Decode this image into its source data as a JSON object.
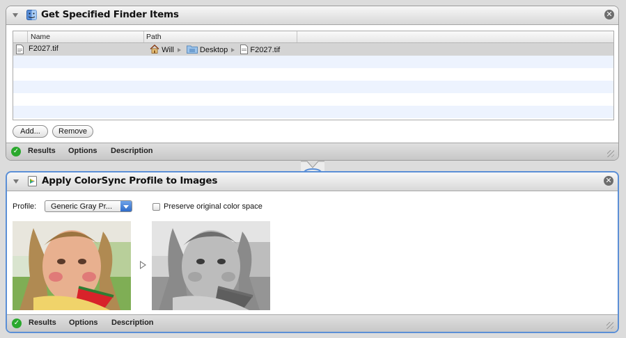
{
  "actions": [
    {
      "title": "Get Specified Finder Items",
      "icon": "finder-icon",
      "table": {
        "columns": [
          "Name",
          "Path"
        ],
        "rows": [
          {
            "name": "F2027.tif",
            "path": [
              "Will",
              "Desktop",
              "F2027.tif"
            ]
          }
        ]
      },
      "buttons": {
        "add": "Add...",
        "remove": "Remove"
      },
      "footer": {
        "results": "Results",
        "options": "Options",
        "description": "Description"
      }
    },
    {
      "title": "Apply ColorSync Profile to Images",
      "icon": "colorsync-icon",
      "profile_label": "Profile:",
      "profile_value": "Generic Gray Pr...",
      "preserve_label": "Preserve original color space",
      "preserve_checked": false,
      "footer": {
        "results": "Results",
        "options": "Options",
        "description": "Description"
      }
    }
  ],
  "colors": {
    "selected_border": "#5b8fd6",
    "alt_row": "#edf3fe",
    "status_green": "#2aa82d"
  }
}
